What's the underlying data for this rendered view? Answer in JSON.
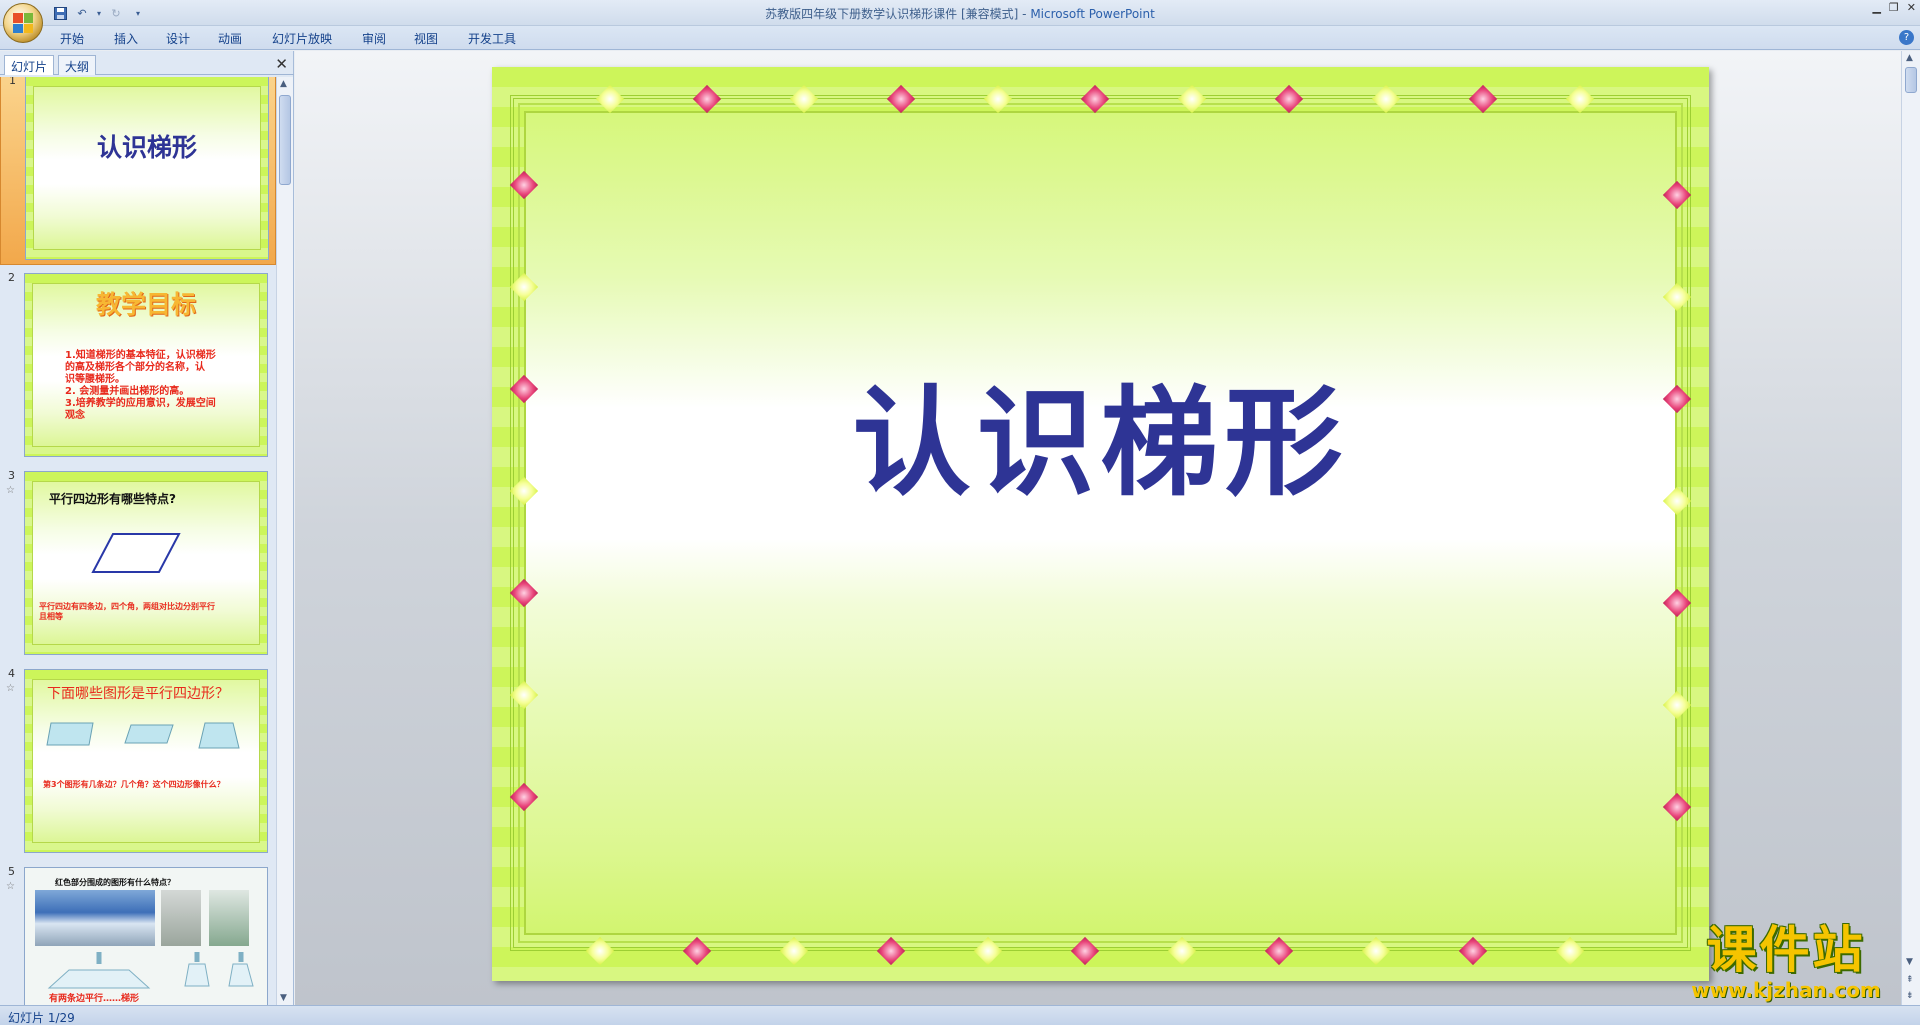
{
  "window": {
    "title": "苏教版四年级下册数学认识梯形课件 [兼容模式]",
    "app_name": "Microsoft PowerPoint"
  },
  "ribbon": {
    "tabs": [
      "开始",
      "插入",
      "设计",
      "动画",
      "幻灯片放映",
      "审阅",
      "视图",
      "开发工具"
    ]
  },
  "left_pane": {
    "tabs": [
      "幻灯片",
      "大纲"
    ],
    "slides": [
      {
        "number": "1",
        "title": "认识梯形"
      },
      {
        "number": "2",
        "title": "教学目标",
        "body": "1.知道梯形的基本特征，认识梯形\n的高及梯形各个部分的名称，认\n识等腰梯形。\n2. 会测量并画出梯形的高。\n3.培养教学的应用意识，发展空间\n观念"
      },
      {
        "number": "3",
        "title": "平行四边形有哪些特点?",
        "body": "平行四边有四条边，四个角，两组对比边分别平行\n且相等"
      },
      {
        "number": "4",
        "title": "下面哪些图形是平行四边形？",
        "body": "第3个图形有几条边？几个角？这个四边形像什么？"
      },
      {
        "number": "5",
        "title": "红色部分围成的图形有什么特点？",
        "body": "有两条边平行……梯形"
      }
    ]
  },
  "slide": {
    "title": "认识梯形"
  },
  "status": {
    "slide_indicator": "幻灯片 1/29"
  },
  "watermark": {
    "text": "课件站",
    "url": "www.kjzhan.com"
  },
  "colors": {
    "slide_title": "#2e3495",
    "slide_bg": "#cdf55a",
    "watermark": "#f5c400"
  }
}
